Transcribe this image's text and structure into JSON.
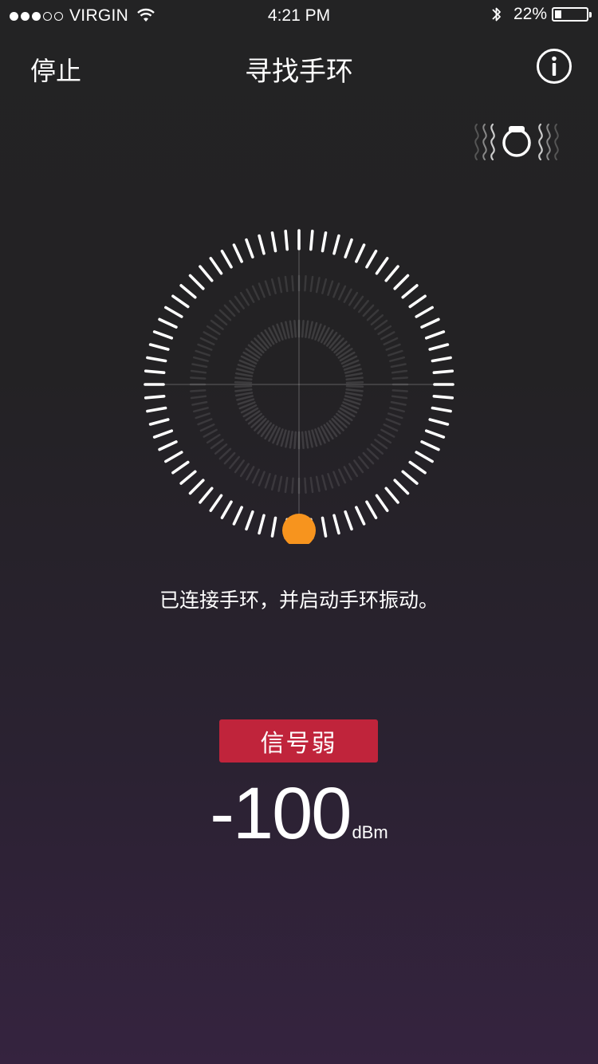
{
  "status_bar": {
    "carrier": "VIRGIN",
    "time": "4:21 PM",
    "battery_percent": "22%",
    "battery_level": 0.22,
    "signal_strength_dots": 3
  },
  "nav": {
    "left_label": "停止",
    "title": "寻找手环",
    "info_icon": "info-icon"
  },
  "band_vibrate_icon": "band-vibration-icon",
  "radar": {
    "accent_color": "#f7941e"
  },
  "message": "已连接手环，并启动手环振动。",
  "signal": {
    "badge_label": "信号弱",
    "badge_color": "#c0243b",
    "value": "-100",
    "unit": "dBm"
  }
}
